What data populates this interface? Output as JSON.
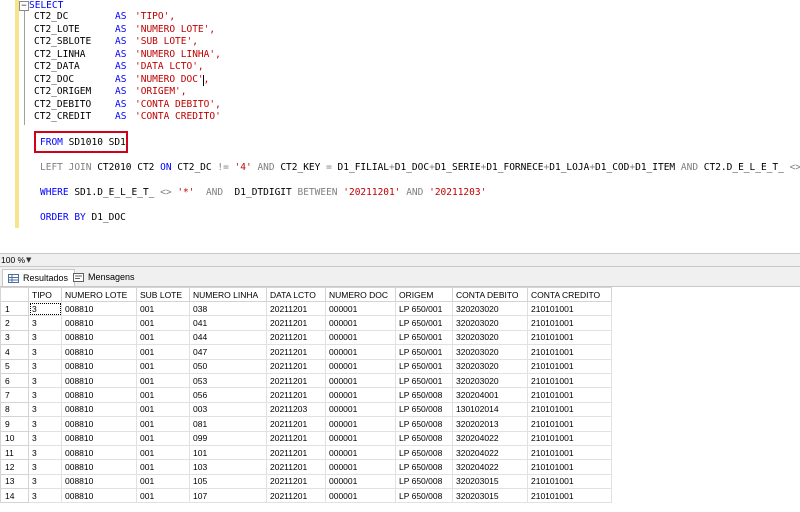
{
  "editor": {
    "select_keyword": "SELECT",
    "columns": [
      {
        "field": "CT2_DC",
        "as": "AS",
        "alias": "'TIPO',"
      },
      {
        "field": "CT2_LOTE",
        "as": "AS",
        "alias": "'NUMERO LOTE',"
      },
      {
        "field": "CT2_SBLOTE",
        "as": "AS",
        "alias": "'SUB LOTE',"
      },
      {
        "field": "CT2_LINHA",
        "as": "AS",
        "alias": "'NUMERO LINHA',"
      },
      {
        "field": "CT2_DATA",
        "as": "AS",
        "alias": "'DATA LCTO',"
      },
      {
        "field": "CT2_DOC",
        "as": "AS",
        "alias": "'NUMERO DOC',"
      },
      {
        "field": "CT2_ORIGEM",
        "as": "AS",
        "alias": "'ORIGEM',"
      },
      {
        "field": "CT2_DEBITO",
        "as": "AS",
        "alias": "'CONTA DEBITO',"
      },
      {
        "field": "CT2_CREDIT",
        "as": "AS",
        "alias": "'CONTA CREDITO'"
      }
    ],
    "from_line": {
      "kw": "FROM",
      "rest": " SD1010 SD1"
    },
    "join_line": {
      "p1": "LEFT JOIN",
      "p2": " CT2010 CT2 ",
      "p3": "ON",
      "p4": " CT2_DC ",
      "p5": "!=",
      "p6": " ",
      "p7": "'4'",
      "p8": " ",
      "p9": "AND",
      "p10": " CT2_KEY ",
      "p11": "=",
      "p12": " D1_FILIAL",
      "p13": "+",
      "p14": "D1_DOC",
      "p15": "+",
      "p16": "D1_SERIE",
      "p17": "+",
      "p18": "D1_FORNECE",
      "p19": "+",
      "p20": "D1_LOJA",
      "p21": "+",
      "p22": "D1_COD",
      "p23": "+",
      "p24": "D1_ITEM ",
      "p25": "AND",
      "p26": " CT2.D_E_L_E_T_ ",
      "p27": "<>",
      "p28": " ",
      "p29": "'*'"
    },
    "where_line": {
      "p1": "WHERE",
      "p2": " SD1.D_E_L_E_T_ ",
      "p3": "<>",
      "p4": " ",
      "p5": "'*'",
      "p6": "  ",
      "p7": "AND",
      "p8": "  D1_DTDIGIT ",
      "p9": "BETWEEN",
      "p10": " ",
      "p11": "'20211201'",
      "p12": " ",
      "p13": "AND",
      "p14": " ",
      "p15": "'20211203'"
    },
    "order_line": {
      "kw": "ORDER BY",
      "rest": " D1_DOC"
    }
  },
  "zoom": {
    "value": "100 %"
  },
  "tabs": [
    {
      "label": "Resultados",
      "icon": "grid-icon"
    },
    {
      "label": "Mensagens",
      "icon": "messages-icon"
    }
  ],
  "results": {
    "headers": [
      "TIPO",
      "NUMERO LOTE",
      "SUB LOTE",
      "NUMERO LINHA",
      "DATA LCTO",
      "NUMERO DOC",
      "ORIGEM",
      "CONTA DEBITO",
      "CONTA CREDITO"
    ],
    "rows": [
      [
        "1",
        "3",
        "008810",
        "001",
        "038",
        "20211201",
        "000001",
        "LP 650/001",
        "320203020",
        "210101001"
      ],
      [
        "2",
        "3",
        "008810",
        "001",
        "041",
        "20211201",
        "000001",
        "LP 650/001",
        "320203020",
        "210101001"
      ],
      [
        "3",
        "3",
        "008810",
        "001",
        "044",
        "20211201",
        "000001",
        "LP 650/001",
        "320203020",
        "210101001"
      ],
      [
        "4",
        "3",
        "008810",
        "001",
        "047",
        "20211201",
        "000001",
        "LP 650/001",
        "320203020",
        "210101001"
      ],
      [
        "5",
        "3",
        "008810",
        "001",
        "050",
        "20211201",
        "000001",
        "LP 650/001",
        "320203020",
        "210101001"
      ],
      [
        "6",
        "3",
        "008810",
        "001",
        "053",
        "20211201",
        "000001",
        "LP 650/001",
        "320203020",
        "210101001"
      ],
      [
        "7",
        "3",
        "008810",
        "001",
        "056",
        "20211201",
        "000001",
        "LP 650/008",
        "320204001",
        "210101001"
      ],
      [
        "8",
        "3",
        "008810",
        "001",
        "003",
        "20211203",
        "000001",
        "LP 650/008",
        "130102014",
        "210101001"
      ],
      [
        "9",
        "3",
        "008810",
        "001",
        "081",
        "20211201",
        "000001",
        "LP 650/008",
        "320202013",
        "210101001"
      ],
      [
        "10",
        "3",
        "008810",
        "001",
        "099",
        "20211201",
        "000001",
        "LP 650/008",
        "320204022",
        "210101001"
      ],
      [
        "11",
        "3",
        "008810",
        "001",
        "101",
        "20211201",
        "000001",
        "LP 650/008",
        "320204022",
        "210101001"
      ],
      [
        "12",
        "3",
        "008810",
        "001",
        "103",
        "20211201",
        "000001",
        "LP 650/008",
        "320204022",
        "210101001"
      ],
      [
        "13",
        "3",
        "008810",
        "001",
        "105",
        "20211201",
        "000001",
        "LP 650/008",
        "320203015",
        "210101001"
      ],
      [
        "14",
        "3",
        "008810",
        "001",
        "107",
        "20211201",
        "000001",
        "LP 650/008",
        "320203015",
        "210101001"
      ]
    ]
  }
}
